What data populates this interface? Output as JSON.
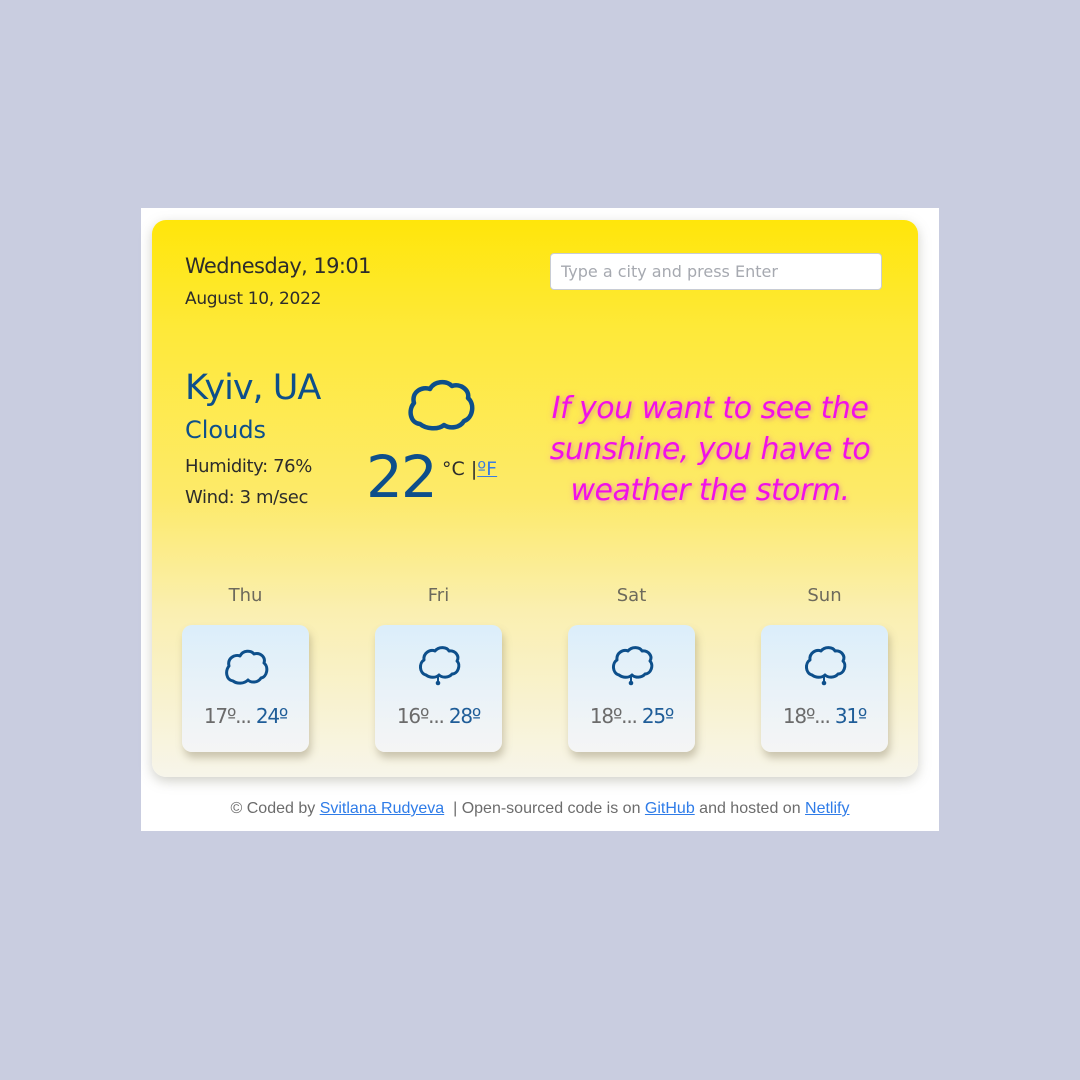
{
  "header": {
    "day_time": "Wednesday, 19:01",
    "date": "August 10, 2022"
  },
  "search": {
    "placeholder": "Type a city and press Enter",
    "value": ""
  },
  "current": {
    "city": "Kyiv, UA",
    "description": "Clouds",
    "humidity": "Humidity: 76%",
    "wind": "Wind: 3 m/sec",
    "temperature": "22",
    "unit_celsius": "°C",
    "unit_separator": " |",
    "unit_fahrenheit": "ºF",
    "icon": "cloud-icon"
  },
  "quote": "If you want to see the sunshine, you have to weather the storm.",
  "forecast": [
    {
      "day": "Thu",
      "min": "17º...",
      "max": "24º",
      "icon": "cloud-icon"
    },
    {
      "day": "Fri",
      "min": "16º...",
      "max": "28º",
      "icon": "cloud-rain-icon"
    },
    {
      "day": "Sat",
      "min": "18º...",
      "max": "25º",
      "icon": "cloud-rain-icon"
    },
    {
      "day": "Sun",
      "min": "18º...",
      "max": "31º",
      "icon": "cloud-rain-icon"
    }
  ],
  "footer": {
    "prefix": "© Coded by ",
    "author": "Svitlana Rudyeva",
    "middle": "  | Open-sourced code is on ",
    "github": "GitHub",
    "hosted": " and hosted on ",
    "netlify": "Netlify"
  },
  "colors": {
    "accent_blue": "#0d4f8b",
    "quote_magenta": "#f20fe8",
    "link_blue": "#2f7ce8",
    "background": "#c9cde0"
  }
}
